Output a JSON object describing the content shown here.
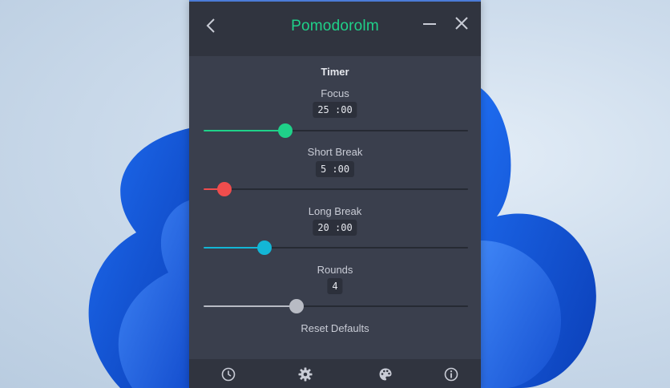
{
  "app": {
    "title": "Pomodorolm",
    "accent_color": "#1fd189",
    "icons": {
      "back": "chevron-left-icon",
      "minimize": "minimize-icon",
      "close": "close-icon"
    }
  },
  "timer": {
    "section_title": "Timer",
    "settings": [
      {
        "label": "Focus",
        "value": "25 :00",
        "level": 0.31,
        "color": "#1fd189"
      },
      {
        "label": "Short Break",
        "value": "5 :00",
        "level": 0.08,
        "color": "#ef4d4d"
      },
      {
        "label": "Long Break",
        "value": "20 :00",
        "level": 0.23,
        "color": "#13b6d6"
      },
      {
        "label": "Rounds",
        "value": "4",
        "level": 0.35,
        "color": "#b8bbc4"
      }
    ],
    "reset_label": "Reset Defaults"
  },
  "bottom_nav": [
    "clock-icon",
    "gear-icon",
    "palette-icon",
    "info-icon"
  ]
}
